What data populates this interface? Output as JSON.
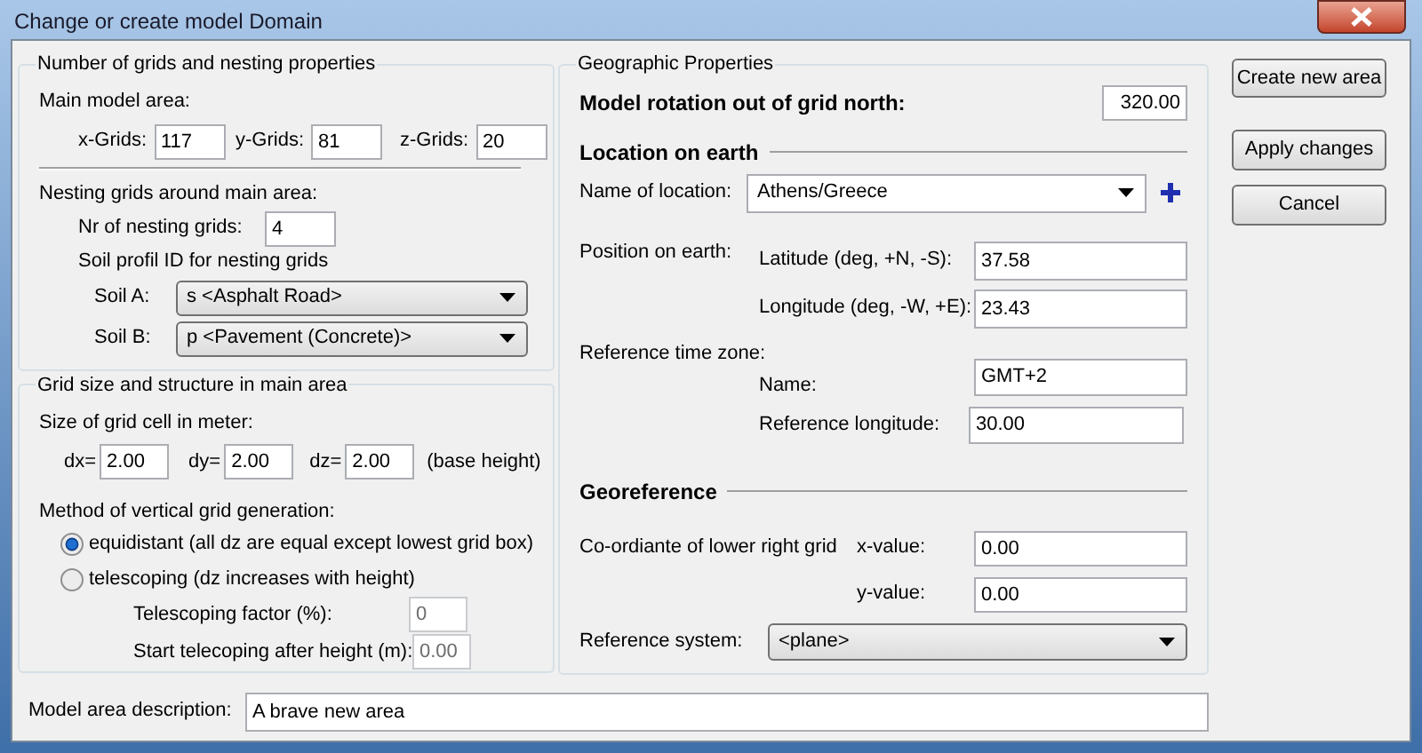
{
  "window": {
    "title": "Change or create model Domain"
  },
  "grids": {
    "title": "Number of grids and nesting properties",
    "main_area_label": "Main model area:",
    "fields": [
      {
        "label": "x-Grids:",
        "value": "117"
      },
      {
        "label": "y-Grids:",
        "value": "81"
      },
      {
        "label": "z-Grids:",
        "value": "20"
      }
    ],
    "nesting_label": "Nesting grids around main area:",
    "nesting_count": {
      "label": "Nr of nesting grids:",
      "value": "4"
    },
    "soil_label": "Soil profil ID for nesting grids",
    "soils": [
      {
        "label": "Soil A:",
        "value": "s <Asphalt Road>"
      },
      {
        "label": "Soil B:",
        "value": "p <Pavement (Concrete)>"
      }
    ]
  },
  "grid_size": {
    "title": "Grid size and structure in main area",
    "cell_size_label": "Size of grid cell in meter:",
    "cells": [
      {
        "label": "dx=",
        "value": "2.00"
      },
      {
        "label": "dy=",
        "value": "2.00"
      },
      {
        "label": "dz=",
        "value": "2.00"
      }
    ],
    "base_height_note": "(base height)",
    "method_label": "Method of vertical grid generation:",
    "methods": [
      {
        "label": "equidistant (all dz are equal except lowest grid box)",
        "selected": true
      },
      {
        "label": "telescoping (dz increases with height)",
        "selected": false
      }
    ],
    "telescoping": [
      {
        "label": "Telescoping factor (%):",
        "value": "0",
        "disabled": true
      },
      {
        "label": "Start telecoping after height (m):",
        "value": "0.00",
        "disabled": true
      }
    ]
  },
  "geo": {
    "title": "Geographic Properties",
    "rotation": {
      "label": "Model rotation out of grid north:",
      "value": "320.00"
    },
    "location_heading": "Location on earth",
    "location": {
      "label": "Name of location:",
      "value": "Athens/Greece"
    },
    "position_label": "Position on earth:",
    "coords": [
      {
        "label": "Latitude (deg, +N, -S):",
        "value": "37.58"
      },
      {
        "label": "Longitude (deg, -W, +E):",
        "value": "23.43"
      }
    ],
    "time_zone_label": "Reference time zone:",
    "time_zone": [
      {
        "label": "Name:",
        "value": "GMT+2"
      },
      {
        "label": "Reference longitude:",
        "value": "30.00"
      }
    ],
    "georeference_heading": "Georeference",
    "coordinate_label": "Co-ordiante of lower right grid",
    "georef": [
      {
        "label": "x-value:",
        "value": "0.00"
      },
      {
        "label": "y-value:",
        "value": "0.00"
      }
    ],
    "reference_system": {
      "label": "Reference system:",
      "value": "<plane>"
    }
  },
  "buttons": [
    {
      "label": "Create new area"
    },
    {
      "label": "Apply changes"
    },
    {
      "label": "Cancel"
    }
  ],
  "description": {
    "label": "Model area description:",
    "value": "A brave new area"
  }
}
